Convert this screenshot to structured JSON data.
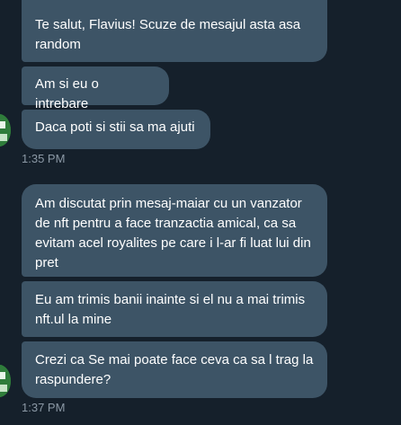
{
  "conversation": {
    "group1": {
      "messages": [
        "Te salut, Flavius! Scuze de mesajul asta asa random",
        "Am si eu o intrebare",
        "Daca poti si stii sa ma ajuti"
      ],
      "timestamp": "1:35 PM"
    },
    "group2": {
      "messages": [
        "Am discutat prin mesaj-maiar cu un vanzator de nft pentru a face tranzactia amical, ca sa evitam acel royalites pe care i l-ar fi luat lui din pret",
        "Eu am trimis banii inainte si el nu a mai trimis nft.ul la mine",
        "Crezi ca Se mai poate face ceva ca sa l trag la raspundere?"
      ],
      "timestamp": "1:37 PM"
    }
  },
  "colors": {
    "background": "#15202b",
    "bubble": "#3d5466",
    "text": "#ffffff",
    "timestamp": "#8b98a5",
    "avatar": "#2f7d3b"
  },
  "icons": {
    "avatar": "user-avatar-icon"
  }
}
